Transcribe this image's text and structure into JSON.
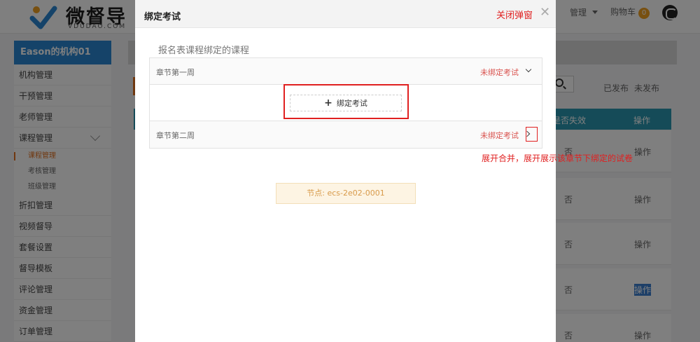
{
  "brand": {
    "name": "微督导",
    "sub": "VDUDAO.COM"
  },
  "topnav": {
    "manage": "管理",
    "cart": "购物车",
    "cart_count": "0"
  },
  "sidebar": {
    "org": "Eason的机构01",
    "items_top": [
      "机构管理",
      "干预管理",
      "老师管理",
      "课程管理"
    ],
    "sub_items": [
      "课程管理",
      "考核管理",
      "班级管理"
    ],
    "items_bottom": [
      "折扣管理",
      "视频督导",
      "套餐设置",
      "督导模板",
      "评论管理",
      "资金管理",
      "订单管理"
    ]
  },
  "list": {
    "tabs": [
      "已发布",
      "未发布"
    ],
    "columns": {
      "invalid": "是否失效",
      "ops": "操作"
    },
    "rows": [
      {
        "invalid": "否",
        "ops": "操作"
      },
      {
        "invalid": "否",
        "ops": "操作"
      },
      {
        "invalid": "否",
        "ops": "操作"
      },
      {
        "invalid": "否",
        "ops": "操作"
      },
      {
        "invalid": "否",
        "ops": "操作"
      }
    ]
  },
  "modal": {
    "title": "绑定考试",
    "close_note": "关闭弹窗",
    "close_symbol": "✕",
    "section_label": "报名表课程绑定的课程",
    "chapters": [
      {
        "name": "章节第一周",
        "status": "未绑定考试",
        "expanded": true
      },
      {
        "name": "章节第二周",
        "status": "未绑定考试",
        "expanded": false
      }
    ],
    "bind_button": "绑定考试",
    "node_label": "节点: ecs-2e02-0001"
  },
  "annotation": "展开合并，展开展示该章节下绑定的试卷",
  "colors": {
    "primary": "#2b87d3",
    "table_head": "#2b97b0",
    "accent": "#e02020",
    "warning_bg": "#fdf4e3"
  }
}
